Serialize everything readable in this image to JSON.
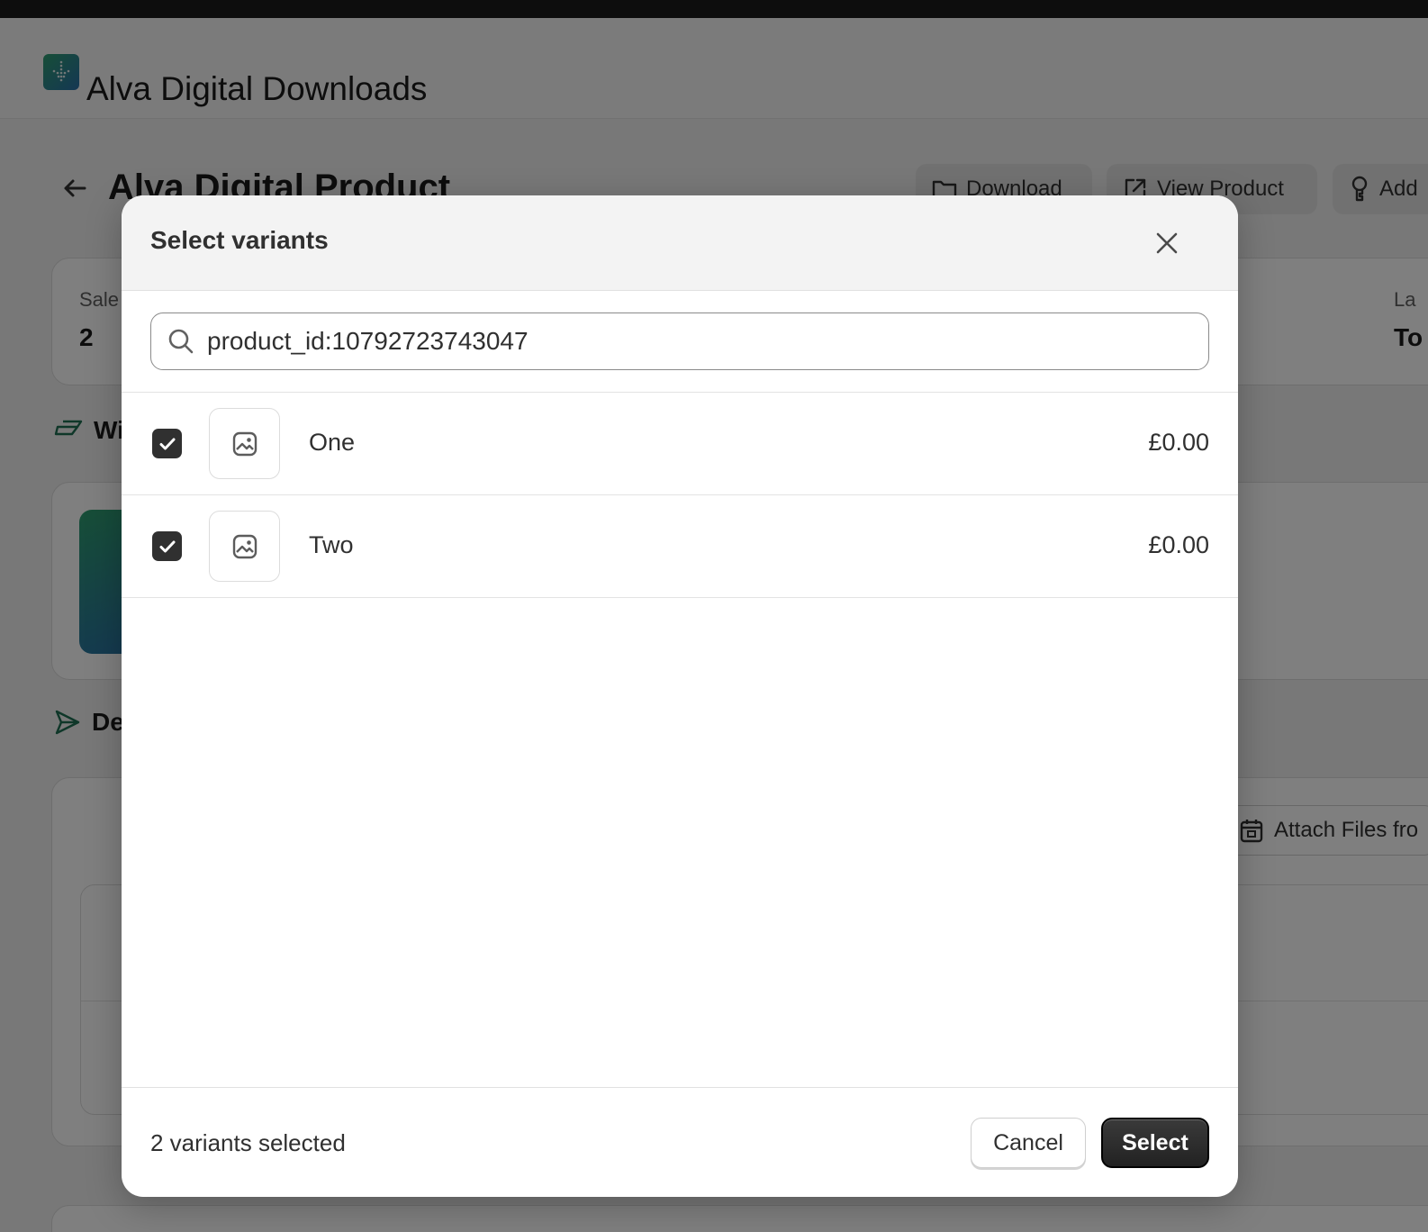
{
  "app": {
    "title": "Alva Digital Downloads"
  },
  "page": {
    "title": "Alva Digital Product",
    "actions": {
      "download": "Download",
      "view_product": "View Product",
      "add": "Add"
    }
  },
  "background": {
    "stat_label_left": "Sale",
    "stat_value_left": "2",
    "stat_label_right": "La",
    "stat_value_right": "To",
    "section_1": "Wi",
    "section_2": "De",
    "attach_files": "Attach Files fro"
  },
  "modal": {
    "title": "Select variants",
    "search": {
      "value": "product_id:10792723743047"
    },
    "variants": [
      {
        "name": "One",
        "price": "£0.00",
        "checked": true
      },
      {
        "name": "Two",
        "price": "£0.00",
        "checked": true
      }
    ],
    "footer": {
      "selected_count": "2 variants selected",
      "cancel": "Cancel",
      "select": "Select"
    }
  },
  "icons": {
    "logo": "download-logo-icon",
    "back": "arrow-left-icon",
    "folder": "folder-icon",
    "external": "external-link-icon",
    "add": "key-icon",
    "close": "close-icon",
    "search": "search-icon",
    "image_placeholder": "image-icon",
    "check": "checkmark-icon"
  },
  "colors": {
    "accent_dark": "#303030",
    "brand_green": "#2e9d6f",
    "brand_blue": "#2a6fa8"
  }
}
